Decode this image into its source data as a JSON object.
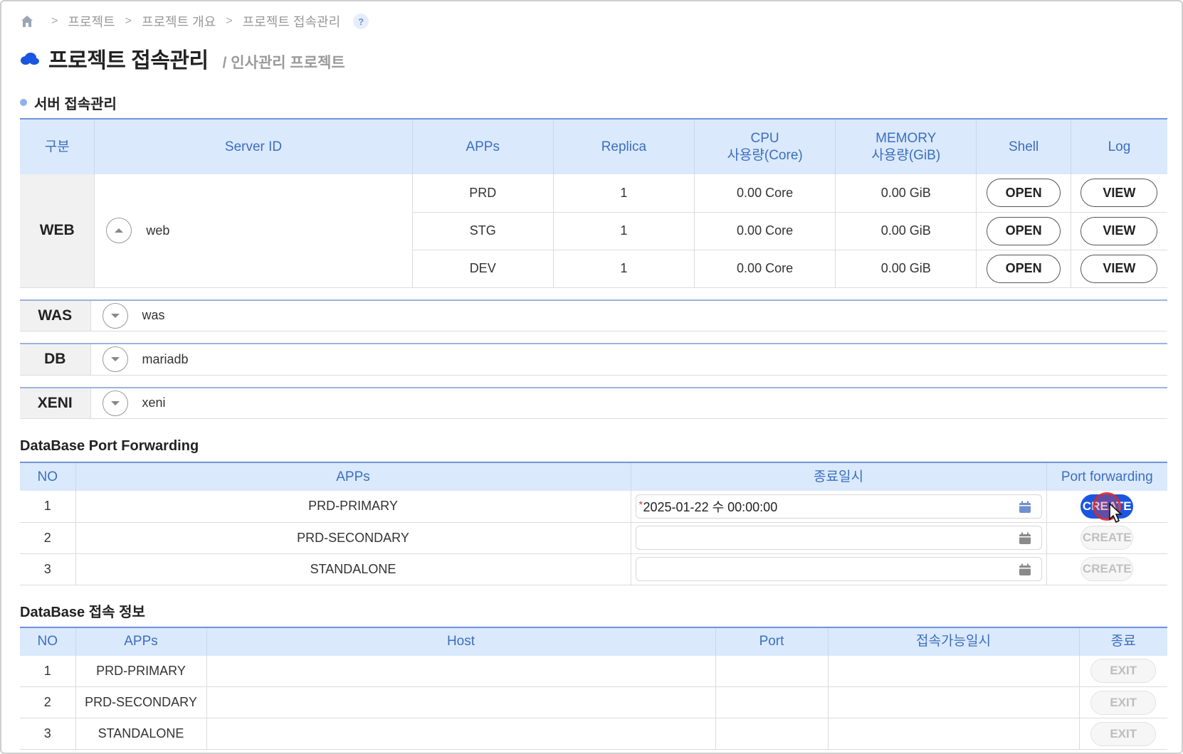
{
  "breadcrumb": {
    "items": [
      "프로젝트",
      "프로젝트 개요",
      "프로젝트 접속관리"
    ],
    "help": "?"
  },
  "header": {
    "title": "프로젝트 접속관리",
    "subtitle": "/ 인사관리 프로젝트"
  },
  "server_section": {
    "title": "서버 접속관리",
    "columns": {
      "category": "구분",
      "server_id": "Server ID",
      "apps": "APPs",
      "replica": "Replica",
      "cpu_line1": "CPU",
      "cpu_line2": "사용량(Core)",
      "mem_line1": "MEMORY",
      "mem_line2": "사용량(GiB)",
      "shell": "Shell",
      "log": "Log"
    },
    "web": {
      "category": "WEB",
      "server_id": "web",
      "rows": [
        {
          "app": "PRD",
          "replica": "1",
          "cpu": "0.00 Core",
          "memory": "0.00 GiB",
          "shell": "OPEN",
          "log": "VIEW"
        },
        {
          "app": "STG",
          "replica": "1",
          "cpu": "0.00 Core",
          "memory": "0.00 GiB",
          "shell": "OPEN",
          "log": "VIEW"
        },
        {
          "app": "DEV",
          "replica": "1",
          "cpu": "0.00 Core",
          "memory": "0.00 GiB",
          "shell": "OPEN",
          "log": "VIEW"
        }
      ]
    },
    "collapsed": [
      {
        "category": "WAS",
        "server_id": "was"
      },
      {
        "category": "DB",
        "server_id": "mariadb"
      },
      {
        "category": "XENI",
        "server_id": "xeni"
      }
    ]
  },
  "port_forwarding": {
    "title": "DataBase Port Forwarding",
    "columns": {
      "no": "NO",
      "apps": "APPs",
      "end_time": "종료일시",
      "port_forwarding": "Port forwarding"
    },
    "rows": [
      {
        "no": "1",
        "app": "PRD-PRIMARY",
        "end_time": "2025-01-22 수 00:00:00",
        "required_mark": "*",
        "action": "CREATE"
      },
      {
        "no": "2",
        "app": "PRD-SECONDARY",
        "end_time": "",
        "action": "CREATE"
      },
      {
        "no": "3",
        "app": "STANDALONE",
        "end_time": "",
        "action": "CREATE"
      }
    ]
  },
  "db_info": {
    "title": "DataBase 접속 정보",
    "columns": {
      "no": "NO",
      "apps": "APPs",
      "host": "Host",
      "port": "Port",
      "available": "접속가능일시",
      "end": "종료"
    },
    "rows": [
      {
        "no": "1",
        "app": "PRD-PRIMARY",
        "host": "",
        "port": "",
        "available": "",
        "action": "EXIT"
      },
      {
        "no": "2",
        "app": "PRD-SECONDARY",
        "host": "",
        "port": "",
        "available": "",
        "action": "EXIT"
      },
      {
        "no": "3",
        "app": "STANDALONE",
        "host": "",
        "port": "",
        "available": "",
        "action": "EXIT"
      }
    ]
  },
  "colors": {
    "accent": "#1a56e0",
    "header_bg": "#dbe9fd",
    "header_text": "#3b6fbf"
  }
}
